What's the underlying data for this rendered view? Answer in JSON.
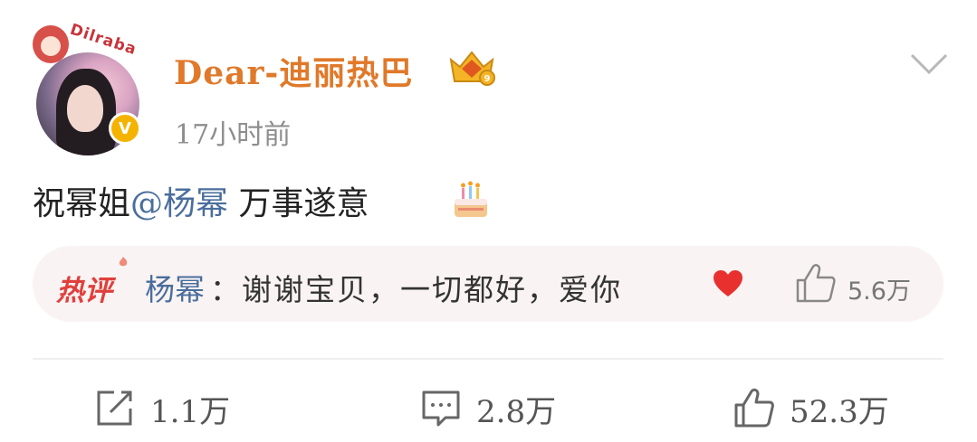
{
  "post": {
    "avatar_pendant_text": "Dilraba",
    "verified_badge": "V",
    "username": "Dear-迪丽热巴",
    "time": "17小时前",
    "text_before": "祝幂姐",
    "mention": "@杨幂",
    "text_after": "万事遂意",
    "emoji": "birthday-cake"
  },
  "hot_comment": {
    "tag": "热评",
    "author": "杨幂",
    "text": "：谢谢宝贝，一切都好，爱你",
    "emoji": "red-heart",
    "likes": "5.6万"
  },
  "actions": {
    "share_count": "1.1万",
    "comment_count": "2.8万",
    "like_count": "52.3万"
  },
  "colors": {
    "username": "#e0792a",
    "mention": "#4a6e9c",
    "hot_tag": "#e0403c",
    "hot_bar_bg": "#faf3f3",
    "verified": "#f5b301"
  }
}
